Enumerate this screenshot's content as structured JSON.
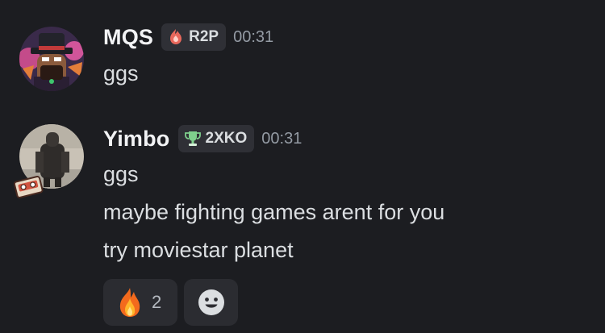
{
  "messages": [
    {
      "username": "MQS",
      "tag": {
        "label": "R2P",
        "icon": "fire-shield-icon"
      },
      "timestamp": "00:31",
      "lines": [
        "ggs"
      ]
    },
    {
      "username": "Yimbo",
      "tag": {
        "label": "2XKO",
        "icon": "trophy-icon"
      },
      "timestamp": "00:31",
      "lines": [
        "ggs",
        "maybe fighting games arent for you",
        "try moviestar planet"
      ],
      "reactions": [
        {
          "emoji": "fire-emoji",
          "count": "2"
        }
      ],
      "add_reaction_icon": "smiley-add-reaction-icon"
    }
  ],
  "colors": {
    "background": "#1c1d21",
    "tag_bg": "#2f3036",
    "reaction_bg": "#2b2c31",
    "timestamp": "#949ba4"
  }
}
